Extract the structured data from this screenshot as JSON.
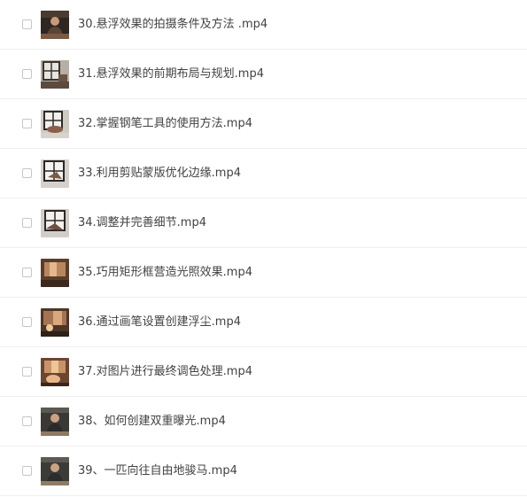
{
  "files": [
    {
      "name": "30.悬浮效果的拍摄条件及方法 .mp4",
      "thumb": "video-thumbnail-presenter-icon"
    },
    {
      "name": "31.悬浮效果的前期布局与规划.mp4",
      "thumb": "video-thumbnail-window-icon"
    },
    {
      "name": "32.掌握钢笔工具的使用方法.mp4",
      "thumb": "video-thumbnail-window-icon"
    },
    {
      "name": "33.利用剪贴蒙版优化边缘.mp4",
      "thumb": "video-thumbnail-window-icon"
    },
    {
      "name": "34.调整并完善细节.mp4",
      "thumb": "video-thumbnail-window-icon"
    },
    {
      "name": "35.巧用矩形框营造光照效果.mp4",
      "thumb": "video-thumbnail-warm-room-icon"
    },
    {
      "name": "36.通过画笔设置创建浮尘.mp4",
      "thumb": "video-thumbnail-warm-room-icon"
    },
    {
      "name": "37.对图片进行最终调色处理.mp4",
      "thumb": "video-thumbnail-warm-room-icon"
    },
    {
      "name": "38、如何创建双重曝光.mp4",
      "thumb": "video-thumbnail-presenter-icon"
    },
    {
      "name": "39、一匹向往自由地骏马.mp4",
      "thumb": "video-thumbnail-presenter-icon"
    }
  ]
}
